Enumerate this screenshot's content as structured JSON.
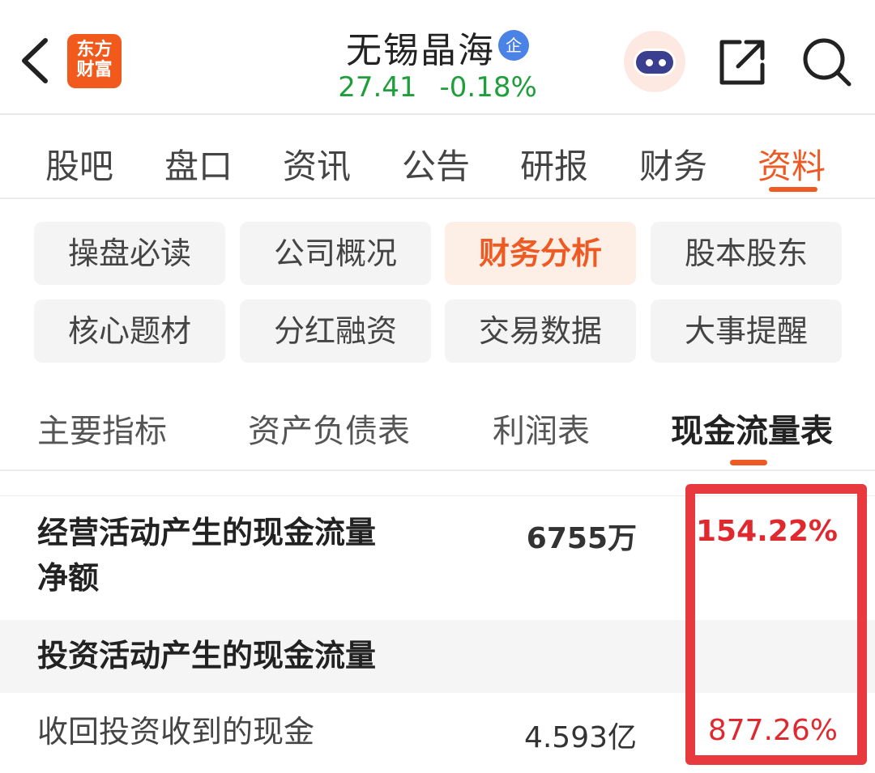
{
  "header": {
    "logo_line1": "东方",
    "logo_line2": "财富",
    "stock_name": "无锡晶海",
    "badge": "企",
    "price": "27.41",
    "change": "-0.18%"
  },
  "main_tabs": [
    "股吧",
    "盘口",
    "资讯",
    "公告",
    "研报",
    "财务",
    "资料"
  ],
  "sub_tabs": [
    "操盘必读",
    "公司概况",
    "财务分析",
    "股本股东",
    "核心题材",
    "分红融资",
    "交易数据",
    "大事提醒"
  ],
  "statement_tabs": [
    "主要指标",
    "资产负债表",
    "利润表",
    "现金流量表"
  ],
  "rows": [
    {
      "label_line1": "经营活动产生的现金流量",
      "label_line2": "净额",
      "value": "6755万",
      "pct": "154.22%"
    },
    {
      "label": "投资活动产生的现金流量"
    },
    {
      "label": "收回投资收到的现金",
      "value": "4.593亿",
      "pct": "877.26%"
    }
  ],
  "colors": {
    "accent": "#ee5a24",
    "down": "#1f9e3b",
    "up": "#e0292f",
    "highlight": "#e8393e"
  }
}
